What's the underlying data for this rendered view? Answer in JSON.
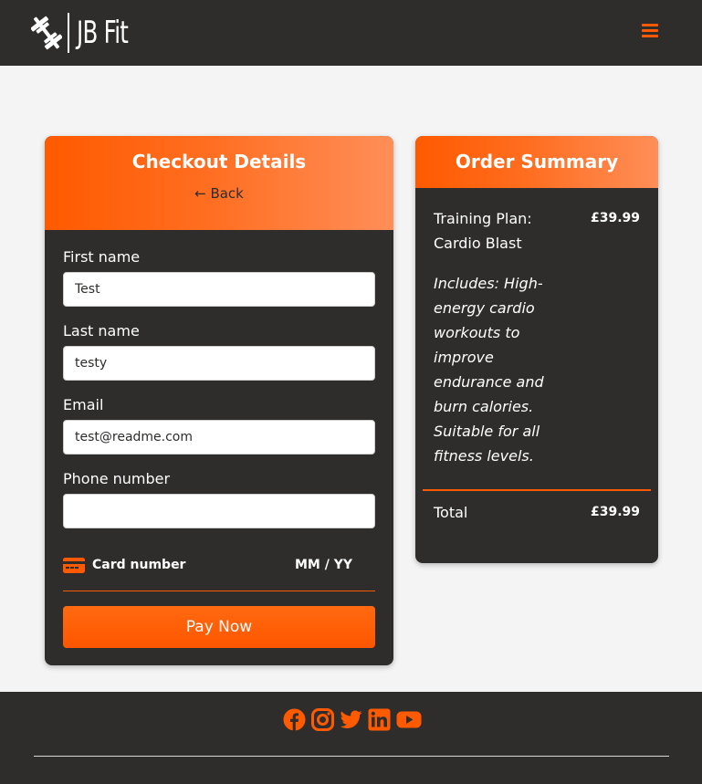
{
  "brand": {
    "name": "JB Fit",
    "logo_icon": "barbell-icon"
  },
  "nav": {
    "menu_icon": "hamburger-icon"
  },
  "colors": {
    "accent": "#ff5a00",
    "dark": "#2e2d2b",
    "background": "#f4f4f4"
  },
  "checkout": {
    "title": "Checkout Details",
    "back_label": "← Back",
    "fields": [
      {
        "label": "First name",
        "value": "Test"
      },
      {
        "label": "Last name",
        "value": "testy"
      },
      {
        "label": "Email",
        "value": "test@readme.com"
      },
      {
        "label": "Phone number",
        "value": ""
      }
    ],
    "card": {
      "icon": "credit-card-icon",
      "number_placeholder": "Card number",
      "expiry_placeholder": "MM / YY"
    },
    "pay_label": "Pay Now"
  },
  "summary": {
    "title": "Order Summary",
    "item_name": "Training Plan: Cardio Blast",
    "item_price": "£39.99",
    "item_description": "Includes: High-energy cardio workouts to improve endurance and burn calories. Suitable for all fitness levels.",
    "total_label": "Total",
    "total_value": "£39.99"
  },
  "footer": {
    "social_icons": [
      "facebook-icon",
      "instagram-icon",
      "twitter-icon",
      "linkedin-icon",
      "youtube-icon"
    ]
  }
}
